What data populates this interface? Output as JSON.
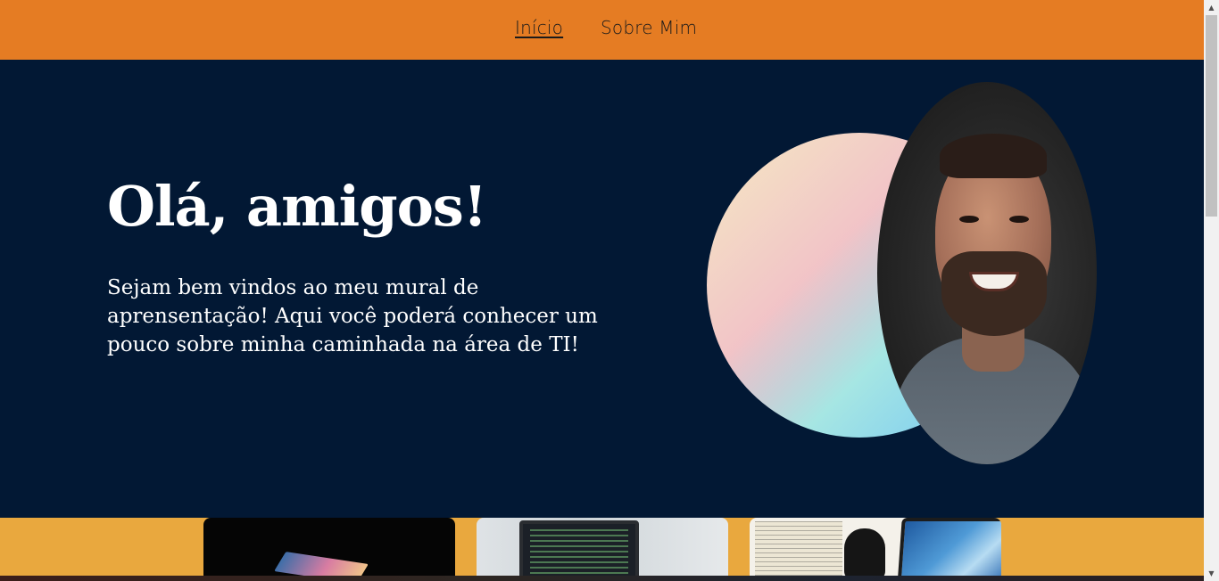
{
  "nav": {
    "items": [
      {
        "label": "Início",
        "active": true
      },
      {
        "label": "Sobre Mim",
        "active": false
      }
    ]
  },
  "hero": {
    "title": "Olá, amigos!",
    "text": "Sejam bem vindos ao meu mural de aprensentação! Aqui você poderá conhecer um pouco sobre minha caminhada na área de TI!"
  },
  "colors": {
    "nav_background": "#e57c23",
    "hero_background": "#021834",
    "cards_band_background": "#e9a83e",
    "text_light": "#ffffff"
  },
  "icons": {
    "scroll_up": "scroll-up-arrow-icon",
    "scroll_down": "scroll-down-arrow-icon"
  }
}
